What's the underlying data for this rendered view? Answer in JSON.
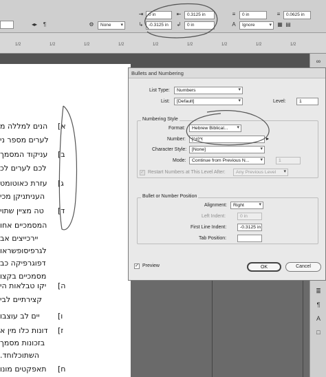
{
  "control_panel": {
    "indent_top_left": "0 in",
    "indent_top_right": "0.3125 in",
    "indent_top_far": "0 in",
    "space_after": "0.0625 in",
    "first_line_indent": "-0.3125 in",
    "space_before": "0 in",
    "char_style": "None",
    "hyphenation": "Ignore"
  },
  "ruler": {
    "ticks": [
      "1/2",
      "1/2",
      "1/2",
      "1/2",
      "1/2",
      "1/2",
      "1/2",
      "1/2",
      "1/2"
    ]
  },
  "document": {
    "markers": [
      "[א",
      "[ב",
      "[ג",
      "[ד",
      "[ה",
      "[ו",
      "[ז",
      "[ח"
    ],
    "lines": [
      "הנים למללה מ",
      "לערים מספר ני",
      "עניקוד המסמך",
      "לכם לערים לכ",
      "עזרת כאוטומט",
      "העניתניקן מכי",
      "טה מציין שתוי",
      "המסמכיים אחו",
      "יירכייצים אב",
      "לגרפיסופשראו",
      "דפוגרפיקה כב",
      "מסמכיים בקצו",
      "יקו טבלאות הי",
      "קצירתיים לבי",
      "יים לב עוצבו",
      "דונות כלו מין א",
      "בזכונות מסמך",
      "השתוכלוחד.",
      "תאפקטים מונו"
    ]
  },
  "dialog": {
    "title": "Bullets and Numbering",
    "list_type_label": "List Type:",
    "list_type_value": "Numbers",
    "list_label": "List:",
    "list_value": "[Default]",
    "level_label": "Level:",
    "level_value": "1",
    "numbering_style_title": "Numbering Style",
    "format_label": "Format:",
    "format_value": "Hebrew Biblical...",
    "number_label": "Number:",
    "number_value": "[^#]^t",
    "char_style_label": "Character Style:",
    "char_style_value": "[None]",
    "mode_label": "Mode:",
    "mode_value": "Continue from Previous N...",
    "mode_number": "1",
    "restart_label": "Restart Numbers at This Level After:",
    "restart_value": "Any Previous Level",
    "position_title": "Bullet or Number Position",
    "alignment_label": "Alignment:",
    "alignment_value": "Right",
    "left_indent_label": "Left Indent:",
    "left_indent_value": "0 in",
    "first_line_label": "First Line Indent:",
    "first_line_value": "-0.3125 in",
    "tab_position_label": "Tab Position:",
    "tab_position_value": "",
    "preview_label": "Preview",
    "ok_label": "OK",
    "cancel_label": "Cancel"
  }
}
